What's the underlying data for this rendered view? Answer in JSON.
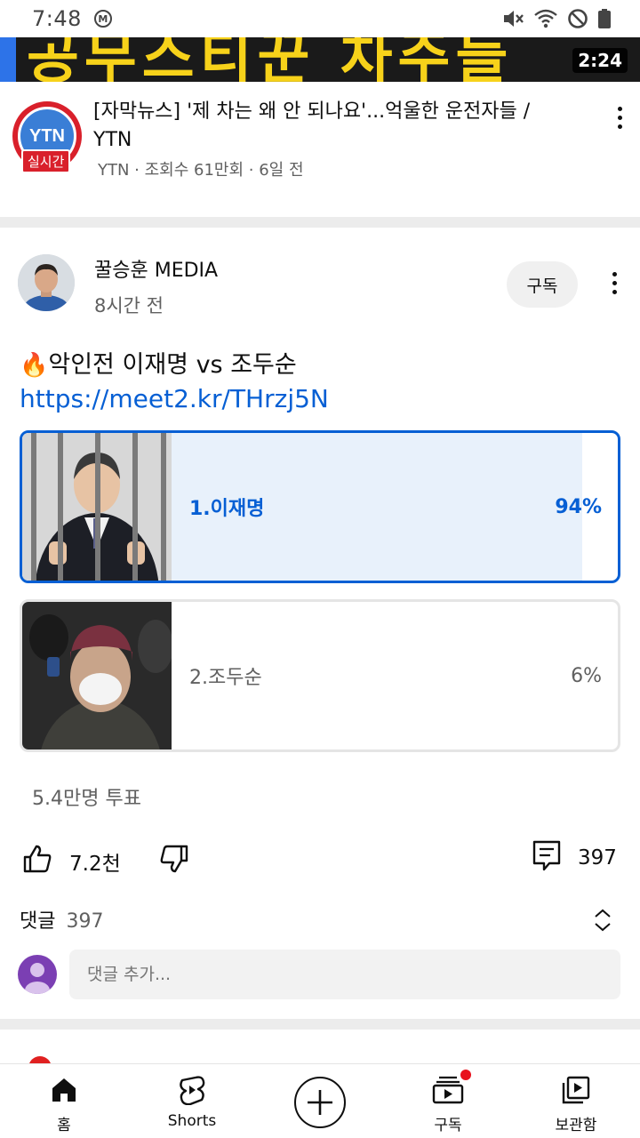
{
  "status_bar": {
    "time": "7:48",
    "carrier_icon_letter": "M"
  },
  "video": {
    "banner_text": "공무스티꾼 차주들",
    "duration": "2:24",
    "channel_logo_text": "YTN",
    "live_label": "실시간",
    "title": "[자막뉴스] '제 차는 왜 안 되나요'...억울한 운전자들 / YTN",
    "meta": "YTN · 조회수 61만회 · 6일 전"
  },
  "post": {
    "channel_name": "꿀승훈 MEDIA",
    "time_ago": "8시간 전",
    "subscribe_label": "구독",
    "text": "악인전 이재명 vs 조두순",
    "text_emoji": "🔥",
    "link": "https://meet2.kr/THrzj5N",
    "poll": {
      "options": [
        {
          "label": "1.이재명",
          "percent_text": "94%",
          "percent": 94,
          "selected": true
        },
        {
          "label": "2.조두순",
          "percent_text": "6%",
          "percent": 6,
          "selected": false
        }
      ],
      "votes": "5.4만명 투표"
    },
    "likes": "7.2천",
    "comment_count": "397",
    "comments_label": "댓글",
    "comments_count_header": "397",
    "comment_placeholder": "댓글 추가..."
  },
  "nav": {
    "items": [
      {
        "label": "홈",
        "icon": "home-icon"
      },
      {
        "label": "Shorts",
        "icon": "shorts-icon"
      },
      {
        "label": "",
        "icon": "create-icon"
      },
      {
        "label": "구독",
        "icon": "subscriptions-icon"
      },
      {
        "label": "보관함",
        "icon": "library-icon"
      }
    ]
  },
  "colors": {
    "accent_blue": "#065fd4",
    "poll_border": "#065fd4",
    "brand_red": "#e8111c"
  }
}
